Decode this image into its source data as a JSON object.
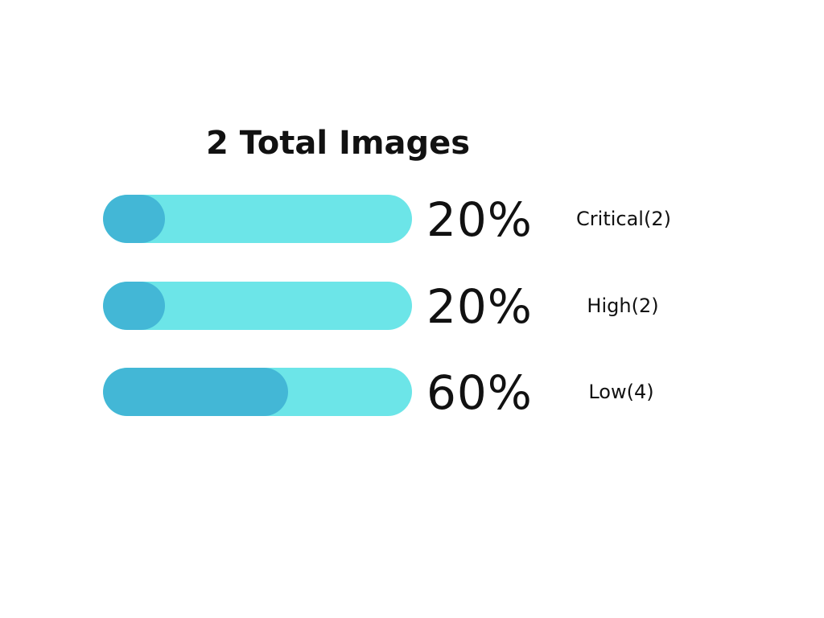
{
  "colors": {
    "track": "#6ce5e8",
    "fill": "#43b7d6",
    "text": "#111111"
  },
  "chart_data": {
    "type": "bar",
    "title": "2 Total Images",
    "categories": [
      "Critical(2)",
      "High(2)",
      "Low(4)"
    ],
    "values": [
      20,
      20,
      60
    ],
    "value_labels": [
      "20%",
      "20%",
      "60%"
    ],
    "unit": "%",
    "ylim": [
      0,
      100
    ],
    "orientation": "horizontal",
    "grid": false
  }
}
